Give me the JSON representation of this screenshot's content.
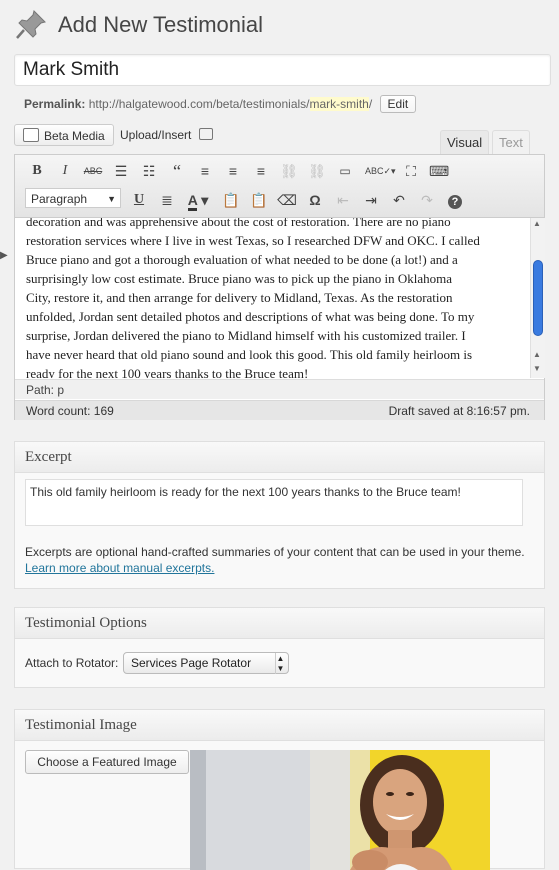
{
  "header": {
    "title": "Add New Testimonial"
  },
  "title_field": {
    "value": "Mark Smith"
  },
  "permalink": {
    "label": "Permalink:",
    "base": "http://halgatewood.com/beta/testimonials/",
    "slug": "mark-smith",
    "trail": "/",
    "edit_label": "Edit"
  },
  "media": {
    "beta_media_label": "Beta Media",
    "upload_insert_label": "Upload/Insert"
  },
  "editor_tabs": {
    "visual": "Visual",
    "text": "Text"
  },
  "editor": {
    "format_selected": "Paragraph",
    "lines": [
      "decoration and was apprehensive about the cost of restoration.  There are no piano",
      "restoration services where I live in west Texas, so I researched DFW and OKC. I called",
      "Bruce piano and got a thorough evaluation of what needed to be done (a lot!) and a",
      "surprisingly low cost estimate.  Bruce piano was to pick up the piano in Oklahoma",
      "City, restore it, and then arrange for delivery to Midland, Texas.  As the restoration",
      "unfolded, Jordan sent detailed photos and descriptions of what was being done. To my",
      "surprise, Jordan delivered the piano to Midland himself with his customized trailer.  I",
      "have never heard that old piano sound and look this good.  This old family heirloom is",
      "ready for the next 100 years thanks to the Bruce team!"
    ],
    "path": "Path: p",
    "word_count": "Word count: 169",
    "draft_saved": "Draft saved at 8:16:57 pm."
  },
  "excerpt": {
    "heading": "Excerpt",
    "value": "This old family heirloom is ready for the next 100 years thanks to the Bruce team!",
    "help": "Excerpts are optional hand-crafted summaries of your content that can be used in your theme.",
    "link": "Learn more about manual excerpts."
  },
  "testimonial_options": {
    "heading": "Testimonial Options",
    "rotator_label": "Attach to Rotator:",
    "rotator_selected": "Services Page Rotator"
  },
  "testimonial_image": {
    "heading": "Testimonial Image",
    "button_label": "Choose a Featured Image"
  },
  "colors": {
    "link": "#21759b",
    "scroll_thumb": "#3a7be0",
    "slug_highlight": "#fffbcc"
  }
}
